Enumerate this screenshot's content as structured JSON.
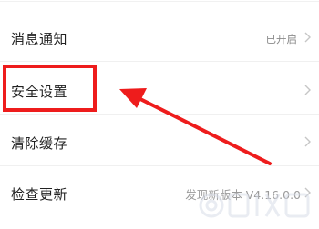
{
  "settings": {
    "items": [
      {
        "label": "消息通知",
        "value": "已开启"
      },
      {
        "label": "安全设置",
        "value": ""
      },
      {
        "label": "清除缓存",
        "value": ""
      },
      {
        "label": "检查更新",
        "value": "发现新版本 V4.16.0.0"
      }
    ]
  },
  "annotation": {
    "highlight_color": "#ee1c1c",
    "target": "安全设置"
  },
  "icons": {
    "chevron": "chevron-right-icon",
    "watermark": "watermark-logo"
  }
}
